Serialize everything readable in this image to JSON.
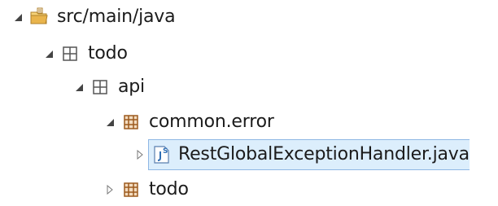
{
  "colors": {
    "package_brown": "#9c5a1e",
    "package_gray": "#555555",
    "selection_bg": "#dceefc",
    "selection_border": "#8fb7e4",
    "folder_yellow": "#e9b44c",
    "java_blue": "#2f6fb5"
  },
  "tree": [
    {
      "label": "src/main/java",
      "icon": "source-folder-icon",
      "expanded": true
    },
    {
      "label": "todo",
      "icon": "empty-package-icon",
      "expanded": true
    },
    {
      "label": "api",
      "icon": "empty-package-icon",
      "expanded": true
    },
    {
      "label": "common.error",
      "icon": "package-icon",
      "expanded": true
    },
    {
      "label": "RestGlobalExceptionHandler.java",
      "icon": "java-file-icon",
      "expanded": false,
      "selected": true
    },
    {
      "label": "todo",
      "icon": "package-icon",
      "expanded": false
    }
  ]
}
